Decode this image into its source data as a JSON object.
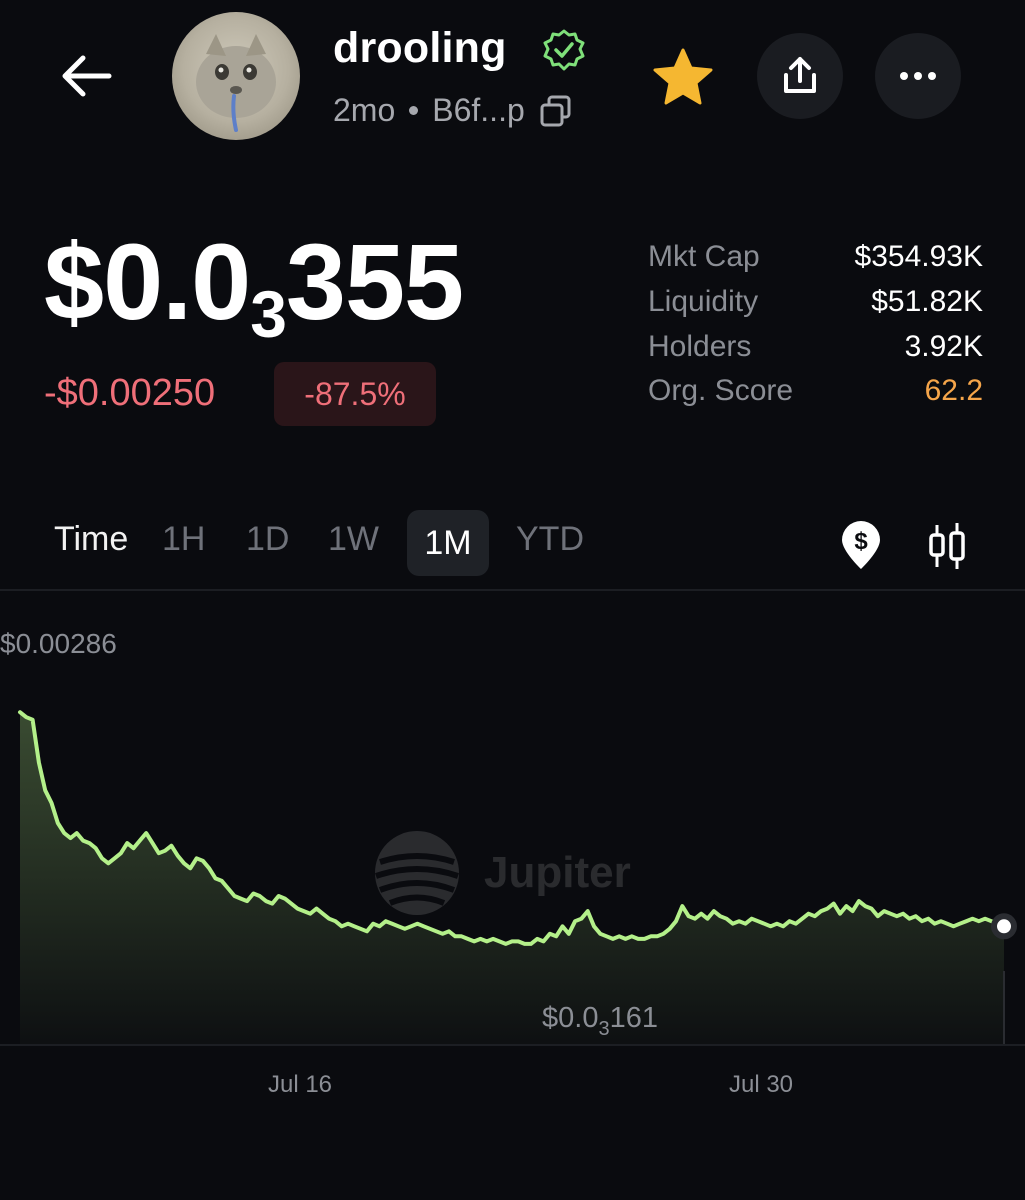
{
  "header": {
    "token_name": "drooling",
    "age": "2mo",
    "address": "B6f...p"
  },
  "price": {
    "prefix": "$0.0",
    "zeros_subscript": "3",
    "suffix": "355",
    "change_abs": "-$0.00250",
    "change_pct": "-87.5%"
  },
  "stats": [
    {
      "label": "Mkt Cap",
      "value": "$354.93K"
    },
    {
      "label": "Liquidity",
      "value": "$51.82K"
    },
    {
      "label": "Holders",
      "value": "3.92K"
    },
    {
      "label": "Org. Score",
      "value": "62.2"
    }
  ],
  "tabs": {
    "time": "Time",
    "h1": "1H",
    "d1": "1D",
    "w1": "1W",
    "m1": "1M",
    "ytd": "YTD",
    "active": "1M"
  },
  "colors": {
    "accent_green": "#b4f08a",
    "negative_red": "#ef6f79",
    "score_orange": "#f5a54a",
    "star_gold": "#f5b731"
  },
  "chart_data": {
    "type": "area",
    "watermark": "Jupiter",
    "max_label": "$0.00286",
    "min_label_prefix": "$0.0",
    "min_label_sub": "3",
    "min_label_suffix": "161",
    "x_ticks": [
      "Jul 16",
      "Jul 30"
    ],
    "x": [
      0,
      0.5,
      1,
      1.5,
      2,
      2.5,
      3,
      3.5,
      4,
      4.5,
      5,
      5.5,
      6,
      6.5,
      7,
      7.5,
      8,
      8.5,
      9,
      9.5,
      10,
      10.5,
      11,
      11.5,
      12,
      12.5,
      13,
      13.5,
      14,
      14.5,
      15,
      15.5,
      16,
      16.5,
      17,
      17.5,
      18,
      18.5,
      19,
      19.5,
      20,
      20.5,
      21,
      21.5,
      22,
      22.5,
      23,
      23.5,
      24,
      24.5,
      25,
      25.5,
      26,
      26.5,
      27,
      27.5,
      28,
      28.5,
      29,
      29.5,
      30,
      30.5,
      31,
      31.5,
      32,
      32.5,
      33,
      33.5,
      34,
      34.5,
      35,
      35.5,
      36,
      36.5,
      37,
      37.5,
      38,
      38.5,
      39,
      39.5,
      40,
      40.5,
      41,
      41.5,
      42,
      42.5,
      43,
      43.5,
      44,
      44.5,
      45,
      45.5,
      46,
      46.5,
      47,
      47.5,
      48,
      48.5,
      49,
      49.5,
      50,
      50.5,
      51,
      51.5,
      52,
      52.5,
      53,
      53.5,
      54,
      54.5,
      55,
      55.5,
      56,
      56.5,
      57,
      57.5,
      58,
      58.5,
      59,
      59.5,
      60,
      60.5,
      61,
      61.5,
      62,
      62.5,
      63,
      63.5,
      64,
      64.5,
      65,
      65.5,
      66,
      66.5,
      67,
      67.5,
      68,
      68.5,
      69,
      69.5,
      70,
      70.5,
      71,
      71.5,
      72,
      72.5,
      73,
      73.5,
      74,
      74.5,
      75,
      75.5,
      76,
      76.5,
      77,
      77.5,
      78
    ],
    "values": [
      0.00286,
      0.00284,
      0.00283,
      0.00266,
      0.00255,
      0.0025,
      0.00242,
      0.00238,
      0.00236,
      0.00238,
      0.00235,
      0.00234,
      0.00232,
      0.00228,
      0.00226,
      0.00228,
      0.0023,
      0.00234,
      0.00232,
      0.00235,
      0.00238,
      0.00234,
      0.0023,
      0.00231,
      0.00233,
      0.00229,
      0.00226,
      0.00224,
      0.00228,
      0.00227,
      0.00224,
      0.0022,
      0.00219,
      0.00216,
      0.00213,
      0.00212,
      0.00211,
      0.00214,
      0.00213,
      0.00211,
      0.0021,
      0.00213,
      0.00212,
      0.0021,
      0.00208,
      0.00207,
      0.00206,
      0.00208,
      0.00206,
      0.00204,
      0.00203,
      0.00201,
      0.00202,
      0.00201,
      0.002,
      0.00199,
      0.00202,
      0.00201,
      0.00203,
      0.00202,
      0.00201,
      0.002,
      0.00201,
      0.00202,
      0.00201,
      0.002,
      0.00199,
      0.00198,
      0.00199,
      0.00197,
      0.00197,
      0.00196,
      0.00195,
      0.00196,
      0.00195,
      0.00196,
      0.00195,
      0.00194,
      0.00195,
      0.00195,
      0.00194,
      0.00194,
      0.00196,
      0.00195,
      0.00198,
      0.00197,
      0.00201,
      0.00198,
      0.00203,
      0.00204,
      0.00207,
      0.00201,
      0.00198,
      0.00197,
      0.00196,
      0.00197,
      0.00196,
      0.00197,
      0.00196,
      0.00196,
      0.00197,
      0.00197,
      0.00198,
      0.002,
      0.00203,
      0.00209,
      0.00205,
      0.00204,
      0.00206,
      0.00204,
      0.00207,
      0.00205,
      0.00204,
      0.00202,
      0.00203,
      0.00202,
      0.00204,
      0.00203,
      0.00202,
      0.00201,
      0.00202,
      0.00201,
      0.00203,
      0.00202,
      0.00204,
      0.00206,
      0.00205,
      0.00207,
      0.00208,
      0.0021,
      0.00206,
      0.00209,
      0.00207,
      0.00211,
      0.00209,
      0.00208,
      0.00205,
      0.00207,
      0.00206,
      0.00205,
      0.00206,
      0.00204,
      0.00205,
      0.00203,
      0.00204,
      0.00202,
      0.00203,
      0.00202,
      0.00201,
      0.00202,
      0.00203,
      0.00204,
      0.00203,
      0.00204,
      0.00203,
      0.00202,
      0.00201,
      0.00202,
      0.00201
    ],
    "ylim": [
      0.00161,
      0.00296
    ],
    "xlim": [
      0,
      78
    ],
    "grid": false,
    "legend": "none"
  }
}
